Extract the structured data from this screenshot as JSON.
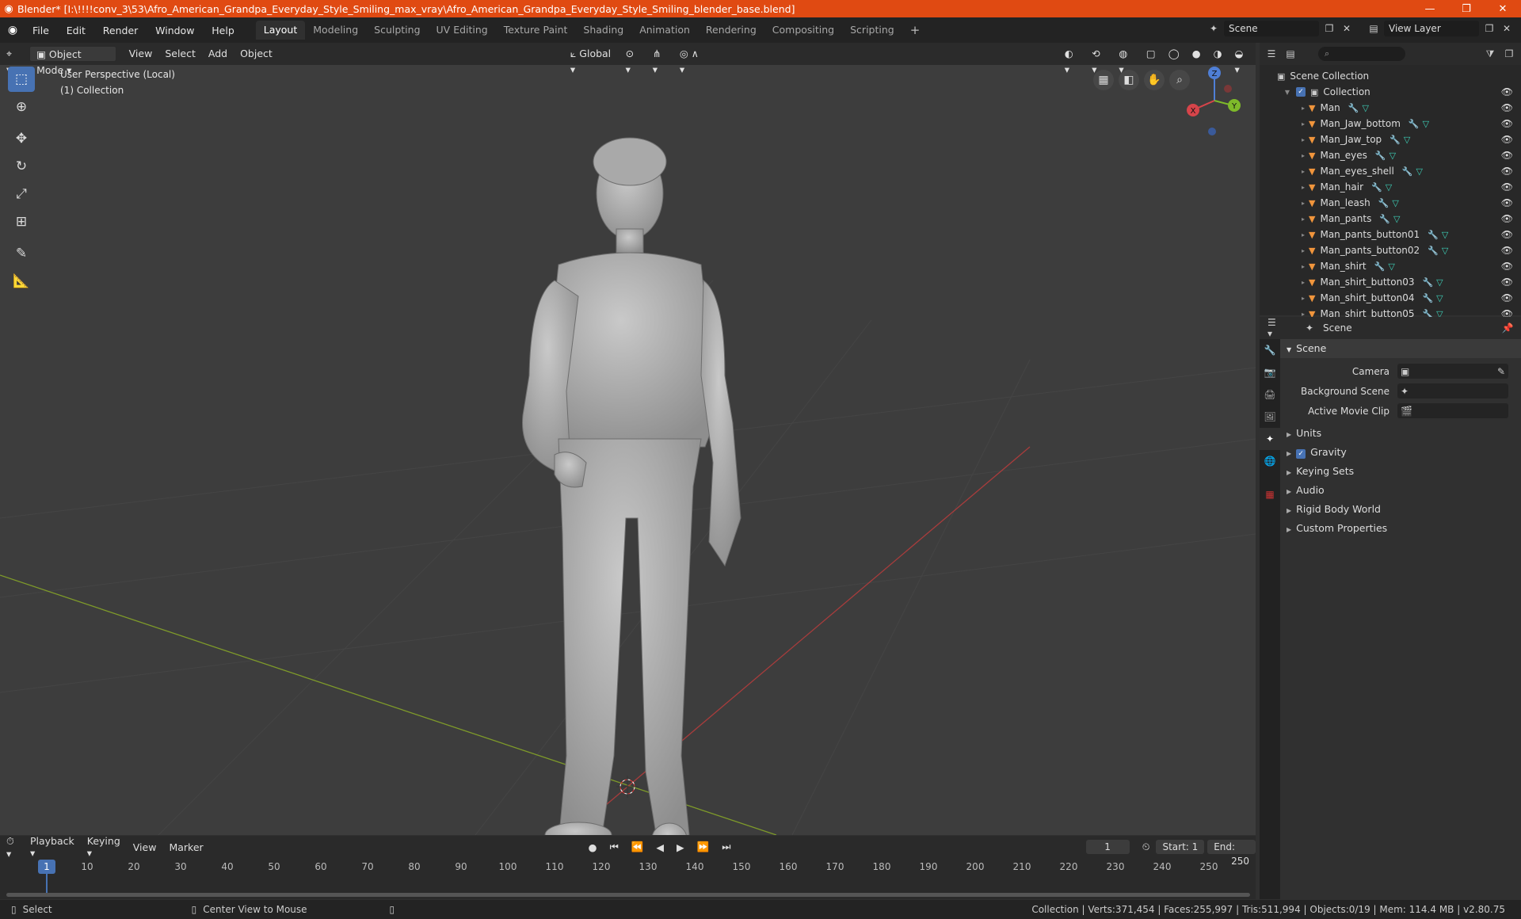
{
  "window": {
    "title": "Blender* [I:\\!!!!conv_3\\53\\Afro_American_Grandpa_Everyday_Style_Smiling_max_vray\\Afro_American_Grandpa_Everyday_Style_Smiling_blender_base.blend]",
    "min": "—",
    "max": "❐",
    "close": "✕"
  },
  "menu": {
    "file": "File",
    "edit": "Edit",
    "render": "Render",
    "window": "Window",
    "help": "Help"
  },
  "workspaces": [
    "Layout",
    "Modeling",
    "Sculpting",
    "UV Editing",
    "Texture Paint",
    "Shading",
    "Animation",
    "Rendering",
    "Compositing",
    "Scripting"
  ],
  "workspace_add": "+",
  "scene_field": "Scene",
  "view_layer_field": "View Layer",
  "viewport": {
    "mode": "Object Mode",
    "view": "View",
    "select": "Select",
    "add": "Add",
    "object": "Object",
    "orientation": "Global",
    "info_line1": "User Perspective (Local)",
    "info_line2": "(1) Collection",
    "gizmo": {
      "z": "Z",
      "x": "X",
      "y": "Y"
    }
  },
  "outliner": {
    "search_placeholder": "⌕",
    "scene_collection": "Scene Collection",
    "collection": "Collection",
    "items": [
      "Man",
      "Man_Jaw_bottom",
      "Man_Jaw_top",
      "Man_eyes",
      "Man_eyes_shell",
      "Man_hair",
      "Man_leash",
      "Man_pants",
      "Man_pants_button01",
      "Man_pants_button02",
      "Man_shirt",
      "Man_shirt_button03",
      "Man_shirt_button04",
      "Man_shirt_button05"
    ]
  },
  "properties": {
    "header": "Scene",
    "section": "Scene",
    "camera_label": "Camera",
    "background_scene_label": "Background Scene",
    "active_movie_clip_label": "Active Movie Clip",
    "panels": [
      "Units",
      "Gravity",
      "Keying Sets",
      "Audio",
      "Rigid Body World",
      "Custom Properties"
    ]
  },
  "timeline": {
    "playback": "Playback",
    "keying": "Keying",
    "view": "View",
    "marker": "Marker",
    "current_frame": "1",
    "start_label": "Start:",
    "start": "1",
    "end_label": "End:",
    "end": "250",
    "ticks": [
      "10",
      "20",
      "30",
      "40",
      "50",
      "60",
      "70",
      "80",
      "90",
      "100",
      "110",
      "120",
      "130",
      "140",
      "150",
      "160",
      "170",
      "180",
      "190",
      "200",
      "210",
      "220",
      "230",
      "240",
      "250"
    ],
    "playhead": "1"
  },
  "status": {
    "select": "Select",
    "center_view": "Center View to Mouse",
    "stats": "Collection | Verts:371,454 | Faces:255,997 | Tris:511,994 | Objects:0/19 | Mem: 114.4 MB | v2.80.75"
  }
}
